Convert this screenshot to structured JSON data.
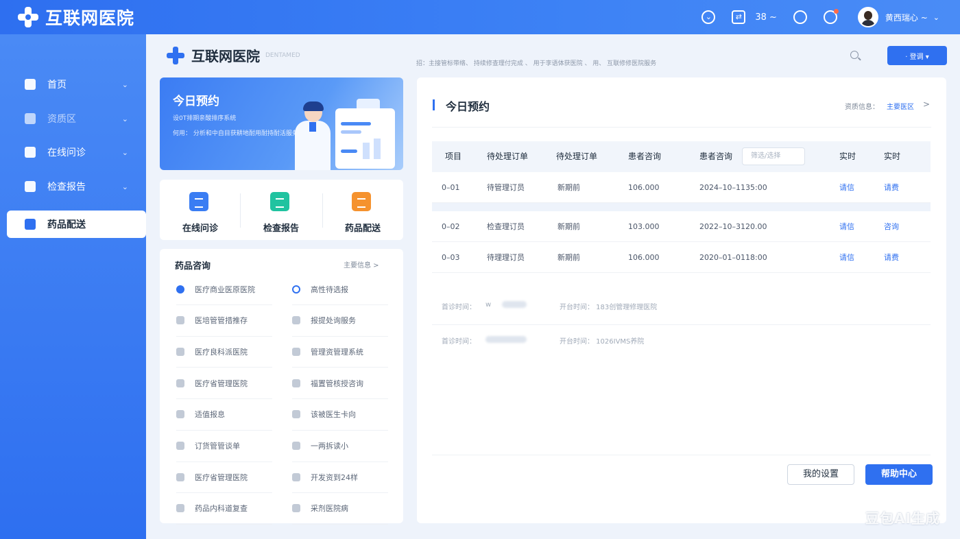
{
  "app": {
    "title": "互联网医院"
  },
  "topbar": {
    "count": "38 ~",
    "user_name": "黄西瑞心 ~"
  },
  "sidebar": {
    "items": [
      {
        "label": "首页"
      },
      {
        "label": "资质区"
      },
      {
        "label": "在线问诊"
      },
      {
        "label": "检查报告"
      },
      {
        "label": "药品配送"
      }
    ]
  },
  "header": {
    "logo_text": "互联网医院",
    "logo_sub": "DENTAMED",
    "notice": "招：主接管标带络、 持续修查理付完成 、 用于李语体获医院 、 用、 互联修修医院服务",
    "login_label": "· 登调 ▾"
  },
  "banner": {
    "title": "今日预约",
    "line1": "设0T排期亲酸排序系统",
    "line2": "何用： 分析和中自目获耕地耐用耐持耐活服务"
  },
  "quick": {
    "items": [
      {
        "label": "在线问诊",
        "color": "#3a7df3"
      },
      {
        "label": "检查报告",
        "color": "#20c3a0"
      },
      {
        "label": "药品配送",
        "color": "#f5922e"
      }
    ]
  },
  "drug": {
    "title": "药品咨询",
    "more": "主要信息 >",
    "left": [
      "医疗商业医原医院",
      "医培管管措推存",
      "医疗良科派医院",
      "医疗省管理医院",
      "适值报息",
      "订货管管谈单",
      "医疗省管理医院",
      "药品内科道复查"
    ],
    "right": [
      "高性待选报",
      "报提处询服务",
      "管理资管理系统",
      "福置管核授咨询",
      "该被医生卡向",
      "一两拆读小",
      "开发资到24样",
      "采剂医院病"
    ]
  },
  "main": {
    "title": "今日预约",
    "info_label": "资质信息：",
    "info_link": "主要医区",
    "chev": ">",
    "headers": [
      "项目",
      "待处理订单",
      "待处理订单",
      "患者咨询",
      "患者咨询",
      "实时",
      "实时"
    ],
    "filter_placeholder": "筛选/选择",
    "rows": [
      {
        "c1": "0–01",
        "c2": "待管理订员",
        "c3": "新期前",
        "c4": "106.000",
        "c5": "2024–10–1135:00",
        "c6": "请信",
        "c7": "请费"
      },
      {
        "c1": "0–02",
        "c2": "检查理订员",
        "c3": "新期前",
        "c4": "103.000",
        "c5": "2022–10–3120.00",
        "c6": "请信",
        "c7": "咨询"
      },
      {
        "c1": "0–03",
        "c2": "待理理订员",
        "c3": "新期前",
        "c4": "106.000",
        "c5": "2020–01–0118:00",
        "c6": "请信",
        "c7": "请费"
      }
    ],
    "meta1_label": "首诊时间：",
    "meta1_val": "w",
    "meta1_right": "开台时间： 183创管理修理医院",
    "meta2_label": "首诊时间：",
    "meta2_right": "开台时间： 1026IVMS养院",
    "btn_settings": "我的设置",
    "btn_help": "帮助中心"
  },
  "watermark": "豆包AI生成"
}
